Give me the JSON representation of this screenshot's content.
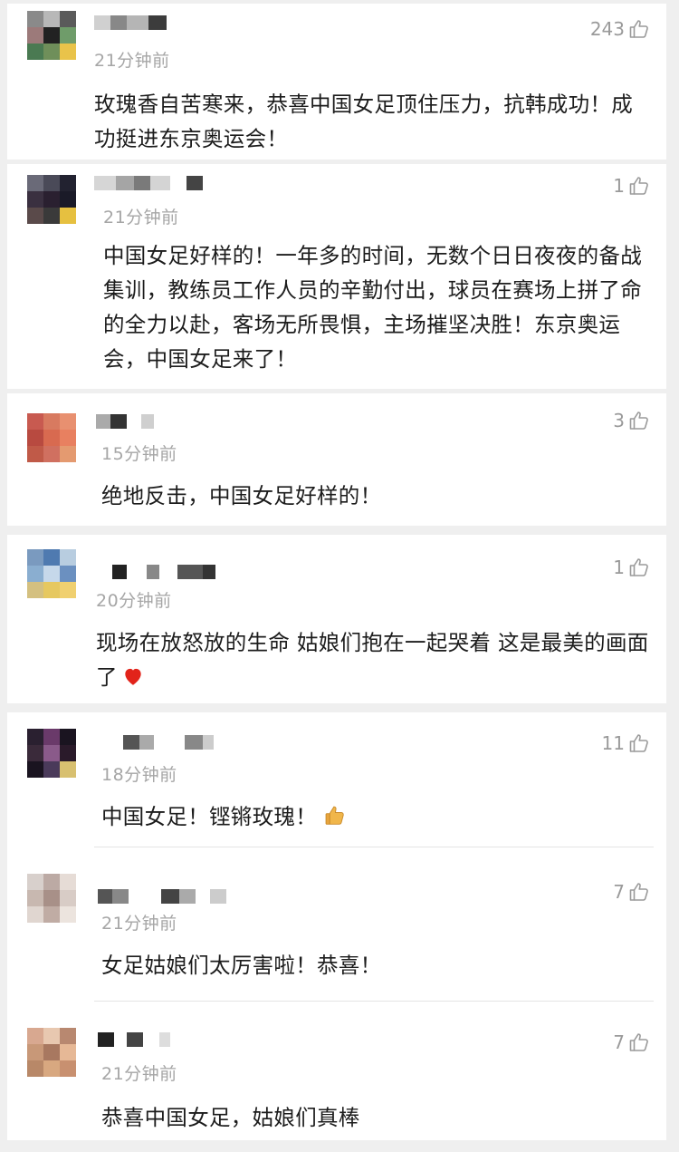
{
  "comments": [
    {
      "time": "21分钟前",
      "likes": "243",
      "text": "玫瑰香自苦寒来，恭喜中国女足顶住压力，抗韩成功！成功挺进东京奥运会！"
    },
    {
      "time": "21分钟前",
      "likes": "1",
      "text": "中国女足好样的！一年多的时间，无数个日日夜夜的备战集训，教练员工作人员的辛勤付出，球员在赛场上拼了命的全力以赴，客场无所畏惧，主场摧坚决胜！东京奥运会，中国女足来了！"
    },
    {
      "time": "15分钟前",
      "likes": "3",
      "text": "绝地反击，中国女足好样的！"
    },
    {
      "time": "20分钟前",
      "likes": "1",
      "text": "现场在放怒放的生命 姑娘们抱在一起哭着 这是最美的画面了"
    },
    {
      "time": "18分钟前",
      "likes": "11",
      "text": "中国女足！铿锵玫瑰！"
    },
    {
      "time": "21分钟前",
      "likes": "7",
      "text": "女足姑娘们太厉害啦！恭喜！"
    },
    {
      "time": "21分钟前",
      "likes": "7",
      "text": "恭喜中国女足，姑娘们真棒"
    }
  ],
  "icons": {
    "like": "thumbs-up-outline-icon",
    "heart": "red-heart-emoji",
    "thumb": "thumbs-up-emoji"
  },
  "colors": {
    "text": "#1c1c1c",
    "time": "#a6a6a6",
    "like": "#9a9a9a",
    "heart": "#e2231a"
  }
}
